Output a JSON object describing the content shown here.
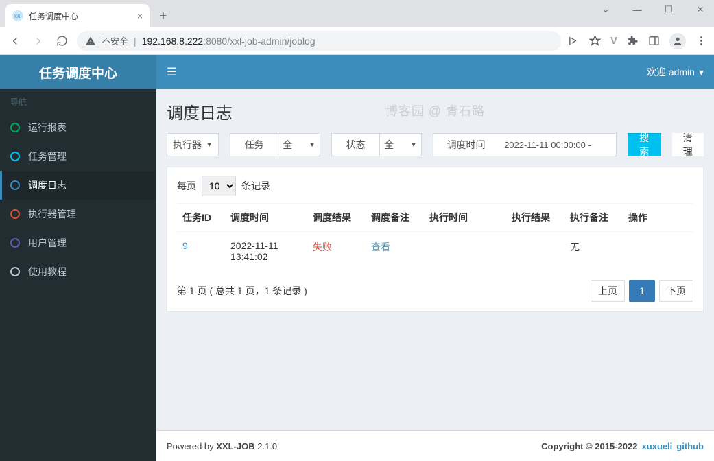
{
  "browser": {
    "tab_title": "任务调度中心",
    "url_insecure_label": "不安全",
    "url_host": "192.168.8.222",
    "url_port": ":8080",
    "url_path": "/xxl-job-admin/joblog"
  },
  "brand": "任务调度中心",
  "nav_header": "导航",
  "nav": [
    {
      "label": "运行报表",
      "icon": "c-green"
    },
    {
      "label": "任务管理",
      "icon": "c-cyan"
    },
    {
      "label": "调度日志",
      "icon": "c-blue",
      "active": true
    },
    {
      "label": "执行器管理",
      "icon": "c-red"
    },
    {
      "label": "用户管理",
      "icon": "c-purple"
    },
    {
      "label": "使用教程",
      "icon": "c-gray"
    }
  ],
  "topbar": {
    "welcome": "欢迎 admin"
  },
  "page_title": "调度日志",
  "watermark": "博客园 @ 青石路",
  "filters": {
    "executor_label": "执行器",
    "task_label": "任务",
    "task_value": "全",
    "status_label": "状态",
    "status_value": "全",
    "dt_label": "调度时间",
    "dt_value": "2022-11-11 00:00:00 -",
    "btn_search": "搜索",
    "btn_clear": "清理"
  },
  "per_page": {
    "prefix": "每页",
    "value": "10",
    "suffix": "条记录"
  },
  "columns": [
    "任务ID",
    "调度时间",
    "调度结果",
    "调度备注",
    "执行时间",
    "执行结果",
    "执行备注",
    "操作"
  ],
  "rows": [
    {
      "task_id": "9",
      "sched_time": "2022-11-11 13:41:02",
      "sched_result": "失败",
      "sched_remark": "查看",
      "exec_time": "",
      "exec_result": "",
      "exec_remark": "无",
      "action": ""
    }
  ],
  "page_info": "第 1 页 ( 总共 1 页，1 条记录 )",
  "pager": {
    "prev": "上页",
    "cur": "1",
    "next": "下页"
  },
  "footer": {
    "powered_prefix": "Powered by ",
    "product": "XXL-JOB",
    "version": " 2.1.0",
    "copyright": "Copyright © 2015-2022",
    "link1": "xuxueli",
    "link2": "github"
  }
}
